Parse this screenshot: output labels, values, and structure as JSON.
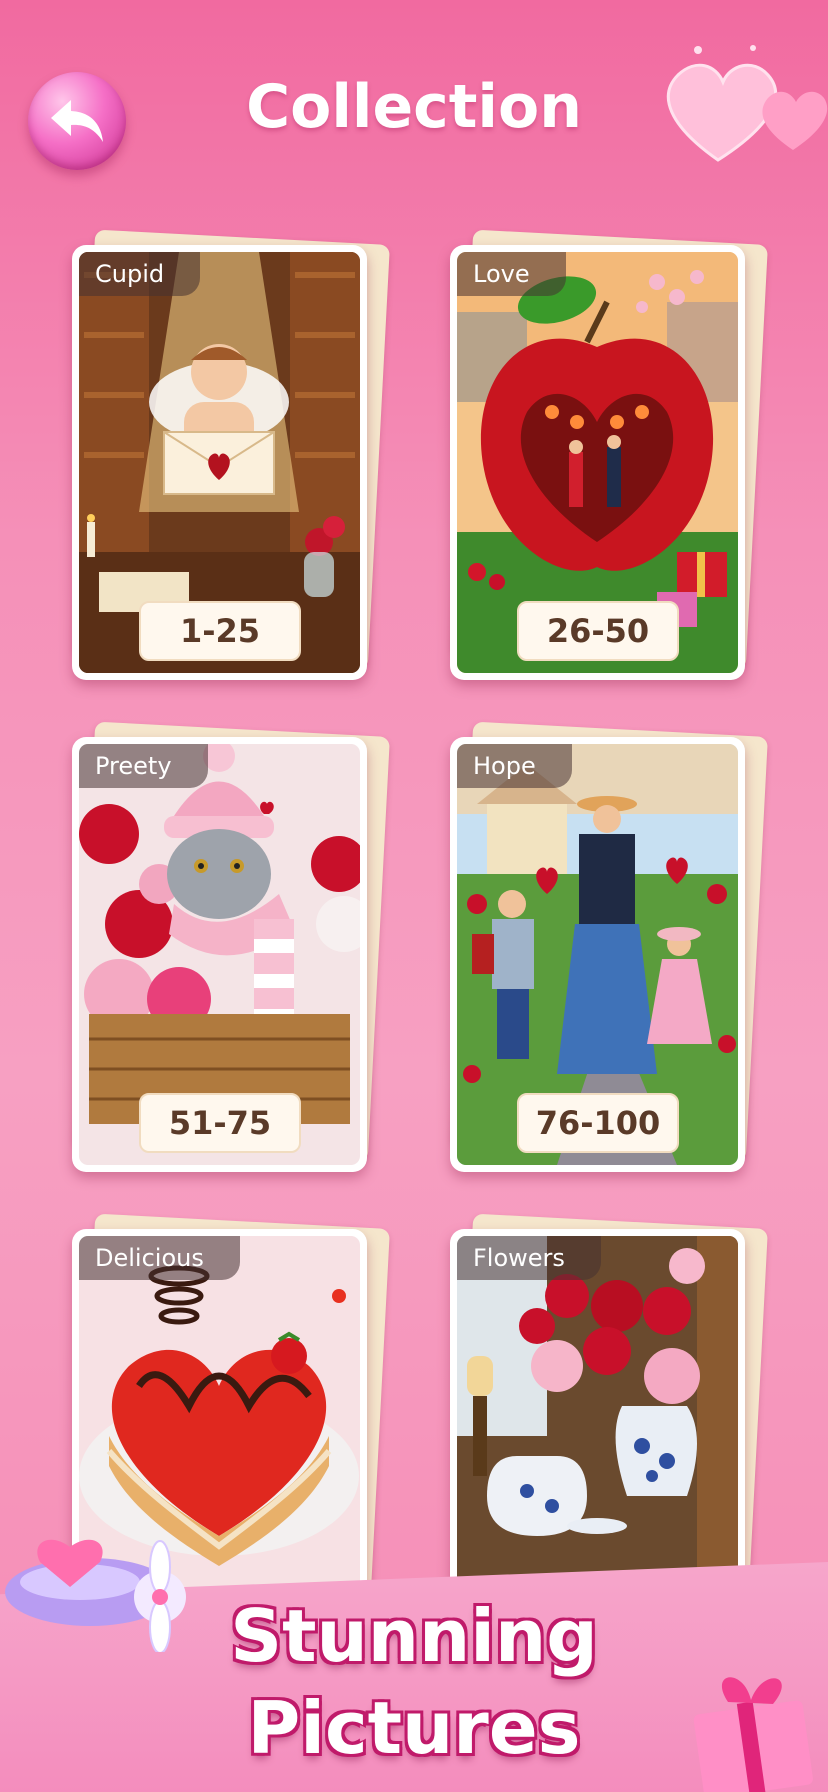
{
  "header": {
    "title": "Collection"
  },
  "collections": [
    {
      "name": "Cupid",
      "range": "1-25"
    },
    {
      "name": "Love",
      "range": "26-50"
    },
    {
      "name": "Preety",
      "range": "51-75"
    },
    {
      "name": "Hope",
      "range": "76-100"
    },
    {
      "name": "Delicious",
      "range": ""
    },
    {
      "name": "Flowers",
      "range": ""
    }
  ],
  "banner": {
    "line1": "Stunning",
    "line2": "Pictures"
  },
  "colors": {
    "background": "#f590b8",
    "accent": "#c01a6a",
    "range_bg": "#fff8ee"
  }
}
